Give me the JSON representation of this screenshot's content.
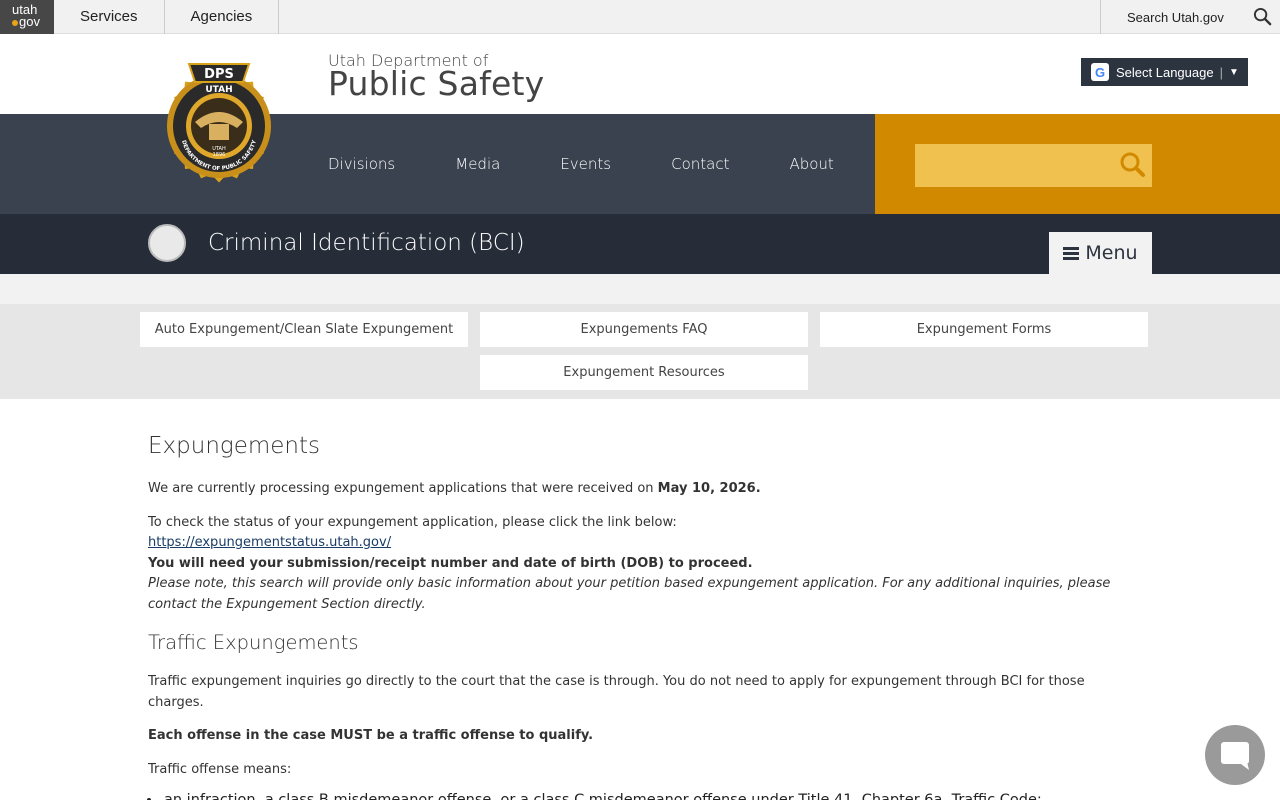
{
  "topbar": {
    "logo_top": "utah",
    "logo_bottom": "gov",
    "items": [
      "Services",
      "Agencies"
    ],
    "search_label": "Search Utah.gov"
  },
  "header": {
    "dept_small": "Utah Department of",
    "dept_big": "Public Safety",
    "language_label": "Select Language",
    "language_arrow": "▼",
    "nav": [
      "Divisions",
      "Media",
      "Events",
      "Contact",
      "About"
    ],
    "search_placeholder": ""
  },
  "seal": {
    "top": "DPS",
    "ring_top": "UTAH",
    "ring_bottom": "DEPARTMENT OF PUBLIC SAFETY",
    "inner": "UTAH",
    "year": "1896"
  },
  "bci": {
    "title": "Criminal Identification (BCI)",
    "menu_label": "Menu"
  },
  "subnav": [
    "Auto Expungement/Clean Slate Expungement",
    "Expungements FAQ",
    "Expungement Forms",
    "Expungement Resources"
  ],
  "content": {
    "title": "Expungements",
    "processing_prefix": "We are currently processing expungement applications that were received on ",
    "processing_date": "May 10, 2026.",
    "check_status": "To check the status of your expungement application, please click the link below:",
    "status_link": "https://expungementstatus.utah.gov/",
    "need_info": "You will need your submission/receipt number and date of birth (DOB) to proceed.",
    "note": "Please note, this search will provide only basic information about your petition based expungement application. For any additional inquiries, please contact the Expungement Section directly.",
    "traffic_title": "Traffic Expungements",
    "traffic_p1": "Traffic expungement inquiries go directly to the court that the case is through. You do not need to apply for expungement through BCI for those charges.",
    "traffic_p2": "Each offense in the case MUST be a traffic offense to qualify.",
    "traffic_p3": "Traffic offense means:",
    "traffic_list": [
      "an infraction, a class B misdemeanor offense, or a class C misdemeanor offense under Title 41, Chapter 6a, Traffic Code;"
    ]
  },
  "colors": {
    "nav_bg": "#3a424f",
    "accent_orange": "#d18a00",
    "search_field": "#f0c14e",
    "bci_bar": "#262d38"
  }
}
